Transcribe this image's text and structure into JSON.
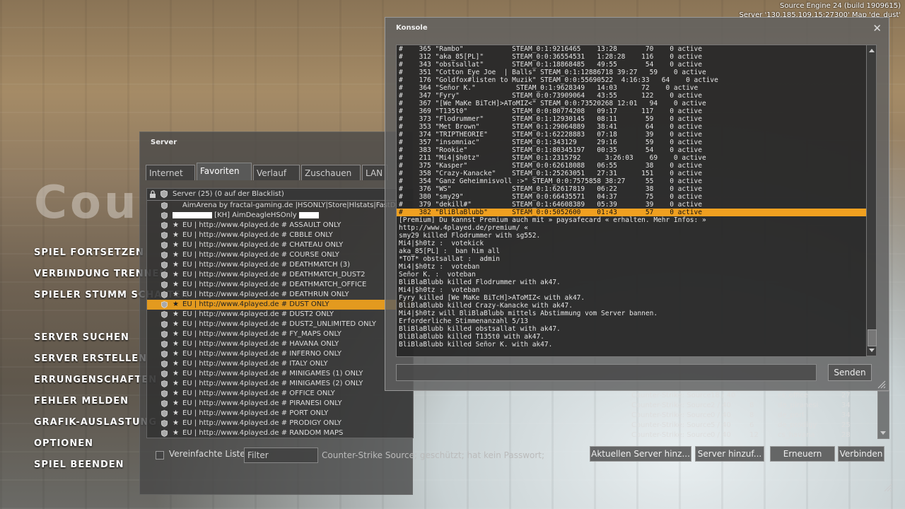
{
  "build_info": {
    "line1": "Source Engine 24 (build 1909615)",
    "line2": "Server '130.185.109.15:27300' Map 'de_dust'"
  },
  "bg_logo": "Cou",
  "main_menu": [
    "SPIEL FORTSETZEN",
    "VERBINDUNG TRENNEN",
    "SPIELER STUMM SCHALTEN",
    "SERVER SUCHEN",
    "SERVER ERSTELLEN",
    "ERRUNGENSCHAFTEN",
    "FEHLER MELDEN",
    "GRAFIK-AUSLASTUNG",
    "OPTIONEN",
    "SPIEL BEENDEN"
  ],
  "server_window": {
    "title": "Server",
    "tabs": [
      "Internet",
      "Favoriten",
      "Verlauf",
      "Zuschauen",
      "LAN"
    ],
    "active_tab": "Favoriten",
    "header": "Server (25) (0 auf der Blacklist)",
    "rows": [
      {
        "name": "AimArena by fractal-gaming.de |HSONLY|Store|Hlstats|FastDL",
        "star": false
      },
      {
        "name": "[KH] AimDeagleHSOnly",
        "star": false,
        "bars": true
      },
      {
        "name": "EU | http://www.4played.de # ASSAULT ONLY",
        "star": true
      },
      {
        "name": "EU | http://www.4played.de # CBBLE ONLY",
        "star": true
      },
      {
        "name": "EU | http://www.4played.de # CHATEAU ONLY",
        "star": true
      },
      {
        "name": "EU | http://www.4played.de # COURSE ONLY",
        "star": true
      },
      {
        "name": "EU | http://www.4played.de # DEATHMATCH (3)",
        "star": true
      },
      {
        "name": "EU | http://www.4played.de # DEATHMATCH_DUST2",
        "star": true
      },
      {
        "name": "EU | http://www.4played.de # DEATHMATCH_OFFICE",
        "star": true
      },
      {
        "name": "EU | http://www.4played.de # DEATHRUN ONLY",
        "star": true
      },
      {
        "name": "EU | http://www.4played.de # DUST ONLY",
        "star": true,
        "selected": true
      },
      {
        "name": "EU | http://www.4played.de # DUST2 ONLY",
        "star": true
      },
      {
        "name": "EU | http://www.4played.de # DUST2_UNLIMITED ONLY",
        "star": true
      },
      {
        "name": "EU | http://www.4played.de # FY_MAPS ONLY",
        "star": true
      },
      {
        "name": "EU | http://www.4played.de # HAVANA ONLY",
        "star": true
      },
      {
        "name": "EU | http://www.4played.de # INFERNO ONLY",
        "star": true
      },
      {
        "name": "EU | http://www.4played.de # ITALY ONLY",
        "star": true
      },
      {
        "name": "EU | http://www.4played.de # MINIGAMES (1) ONLY",
        "star": true
      },
      {
        "name": "EU | http://www.4played.de # MINIGAMES (2) ONLY",
        "star": true
      },
      {
        "name": "EU | http://www.4played.de # OFFICE ONLY",
        "star": true
      },
      {
        "name": "EU | http://www.4played.de # PIRANESI ONLY",
        "star": true
      },
      {
        "name": "EU | http://www.4played.de # PORT ONLY",
        "star": true
      },
      {
        "name": "EU | http://www.4played.de # PRODIGY ONLY",
        "star": true
      },
      {
        "name": "EU | http://www.4played.de # RANDOM MAPS",
        "star": true
      }
    ],
    "simple_list_label": "Vereinfachte Liste",
    "filter_placeholder": "Filter",
    "status": "Counter-Strike Source; geschützt; hat kein Passwort;"
  },
  "bg_server_rows": [
    {
      "game": "Counter-Strike: Source",
      "players": "18 / 40",
      "bots": "",
      "map": "cs_office",
      "latency": "27"
    },
    {
      "game": "Counter-Strike: Source",
      "players": "2 / 40",
      "bots": "8",
      "map": "de_piranesi",
      "latency": "34"
    },
    {
      "game": "Counter-Strike: Source",
      "players": "0 / 40",
      "bots": "8",
      "map": "de_port",
      "latency": "34"
    },
    {
      "game": "Counter-Strike: Source",
      "players": "5 / 40",
      "bots": "6",
      "map": "de_prodigy",
      "latency": "25"
    },
    {
      "game": "Counter-Strike: Source",
      "players": "0 / 40",
      "bots": "12",
      "map": "cs_havana",
      "latency": "28"
    }
  ],
  "buttons": {
    "add_current": "Aktuellen Server hinz...",
    "add_server": "Server hinzuf...",
    "refresh": "Erneuern",
    "connect": "Verbinden"
  },
  "console": {
    "title": "Konsole",
    "close_glyph": "✕",
    "send_label": "Senden",
    "lines": [
      "#    365 \"Rambo\"            STEAM_0:1:9216465    13:28       70    0 active",
      "#    312 \"aka_85[PL]\"       STEAM_0:0:36554531   1:28:28    116    0 active",
      "#    343 \"obstsallat\"       STEAM_0:1:18868485   49:55       54    0 active",
      "#    351 \"Cotton Eye Joe  | Balls\" STEAM_0:1:12886718 39:27   59    0 active",
      "#    176 \"Goldfox#listen to Muzik\" STEAM_0:0:55690522  4:16:33   64    0 active",
      "#    364 \"Señor K.\"          STEAM_0:1:9628349   14:03      72    0 active",
      "#    347 \"Fyry\"             STEAM_0:0:73909064   43:55      122    0 active",
      "#    367 \"[We MaKe BiTcH]>AToMIZ<\" STEAM_0:0:73520268 12:01   94    0 active",
      "#    369 \"T135t0\"           STEAM_0:0:80774208   09:17      117    0 active",
      "#    373 \"Flodrummer\"       STEAM_0:1:12930145   08:11       59    0 active",
      "#    353 \"Met Brown\"        STEAM_0:1:29064889   38:41       64    0 active",
      "#    374 \"TRIPTHEORIE\"      STEAM_0:1:62228883   07:18       39    0 active",
      "#    357 \"insomniac\"        STEAM_0:1:343129     29:16       59    0 active",
      "#    383 \"Rookie\"           STEAM_0:1:80345197   00:35       54    0 active",
      "#    211 \"Mi4|$h0tz\"        STEAM_0:1:2315792      3:26:03    69    0 active",
      "#    375 \"Kasper\"           STEAM_0:0:62618088   06:55       38    0 active",
      "#    358 \"Crazy-Kanacke\"    STEAM_0:1:25263051   27:31      151    0 active",
      "#    354 \"Ganz Geheimnisvoll :>\" STEAM_0:0:7575858 38:27     55    0 active",
      "#    376 \"WS\"               STEAM_0:1:62617819   06:22       38    0 active",
      "#    380 \"smy29\"            STEAM_0:0:66435571   04:37       75    0 active",
      "#    379 \"dekill#\"          STEAM_0:1:64608389   05:39       39    0 active",
      "#    382 \"BliBlaBlubb\"      STEAM_0:0:5052600    01:43       57    0 active",
      "[Premium] Du kannst Premium auch mit » paysafecard « erhalten. Mehr Infos: »",
      "http://www.4played.de/premium/ «",
      "smy29 killed Flodrummer with sg552.",
      "Mi4|$h0tz :  votekick",
      "aka_85[PL] :  ban him all",
      "*TOT* obstsallat :  admin",
      "Mi4|$h0tz :  voteban",
      "Señor K. :  voteban",
      "BliBlaBlubb killed Flodrummer with ak47.",
      "Mi4|$h0tz :  voteban",
      "Fyry killed [We MaKe BiTcH]>AToMIZ< with ak47.",
      "BliBlaBlubb killed Crazy-Kanacke with ak47.",
      "Mi4|$h0tz will BliBlaBlubb mittels Abstimmung vom Server bannen.",
      "Erforderliche Stimmenanzahl 5/13",
      "BliBlaBlubb killed obstsallat with ak47.",
      "BliBlaBlubb killed T135t0 with ak47.",
      "BliBlaBlubb killed Señor K. with ak47."
    ],
    "highlight_index": 21
  },
  "icons": {
    "lock": "lock-icon",
    "vac": "vac-shield-icon",
    "favorite": "star-icon"
  },
  "colors": {
    "selection": "#e39a1f",
    "console_highlight": "#f0a020"
  }
}
